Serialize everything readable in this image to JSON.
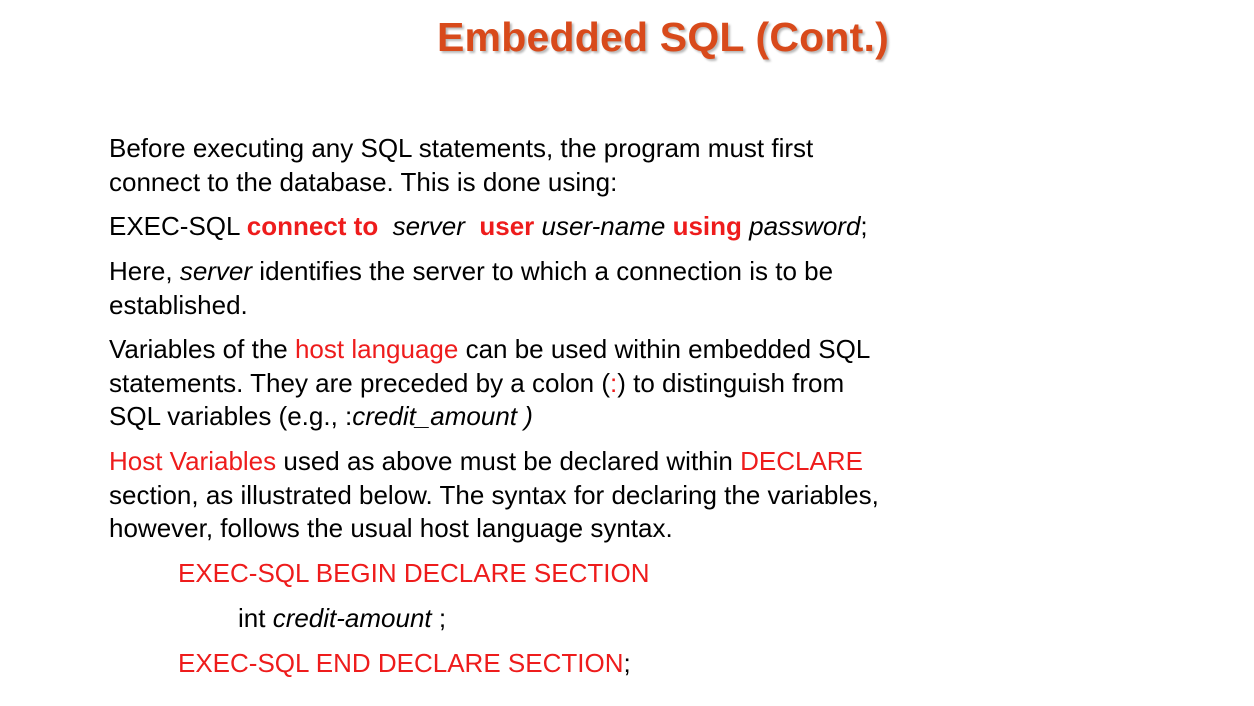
{
  "title": "Embedded SQL (Cont.)",
  "p1": {
    "line1": "Before executing any SQL statements, the program must first",
    "line2": "connect to the database.  This is done using:"
  },
  "p2": {
    "prefix": "EXEC-SQL ",
    "kw_connect": "connect to",
    "server": "server",
    "kw_user": "user",
    "username": "user-name",
    "kw_using": "using",
    "password": "password",
    "semi": ";"
  },
  "p3": {
    "here": "Here, ",
    "server": "server",
    "rest": " identifies the server to which a connection is to be",
    "line2": "established."
  },
  "p4": {
    "l1_a": "Variables of the ",
    "l1_host": "host language",
    "l1_b": " can be used within embedded SQL",
    "l2_a": "statements.  They are preceded  by a colon  (",
    "l2_colon": ":",
    "l2_b": ") to distinguish from",
    "l3_a": "SQL variables (e.g.,  :",
    "l3_var": "credit_amount )"
  },
  "p5": {
    "l1_host": "Host Variables",
    "l1_mid": " used as above must be declared within ",
    "l1_declare": "DECLARE",
    "line2": "section, as illustrated below. The syntax for declaring the variables,",
    "line3": "however, follows the usual host language syntax."
  },
  "code": {
    "begin": "EXEC-SQL BEGIN DECLARE SECTION",
    "int_kw": "int  ",
    "int_var": "credit-amount",
    "int_semi": " ;",
    "end": "EXEC-SQL END DECLARE SECTION",
    "end_semi": ";"
  },
  "colors": {
    "title": "#d84a1b",
    "highlight": "#ee1c1c",
    "text": "#000000"
  }
}
